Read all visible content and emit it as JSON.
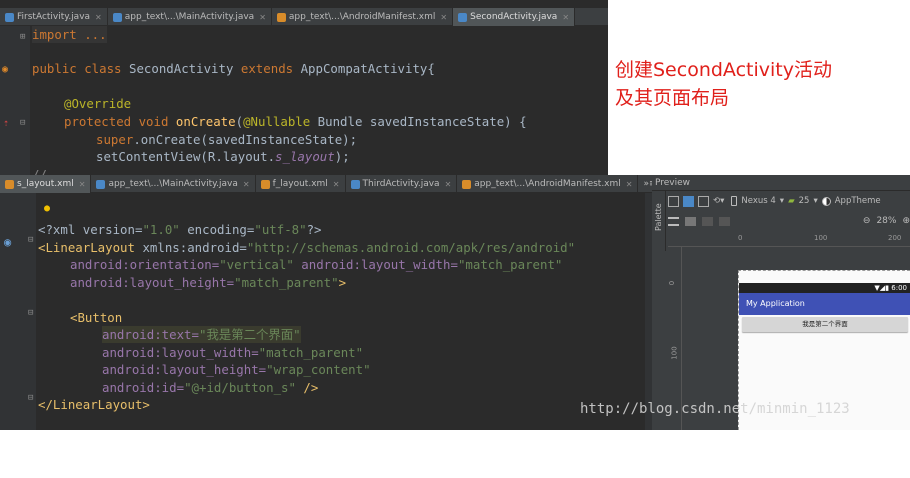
{
  "top_editor": {
    "tabs": [
      {
        "label": "FirstActivity.java",
        "icon": "java-class-icon"
      },
      {
        "label": "app_text\\...\\MainActivity.java",
        "icon": "java-class-icon"
      },
      {
        "label": "app_text\\...\\AndroidManifest.xml",
        "icon": "xml-file-icon"
      },
      {
        "label": "SecondActivity.java",
        "icon": "java-class-icon"
      }
    ],
    "active_tab": 3,
    "lines": {
      "l1": "import ...",
      "l2a": "public class ",
      "l2b": "SecondActivity ",
      "l2c": "extends ",
      "l2d": "AppCompatActivity{",
      "l3": "@Override",
      "l4a": "protected void ",
      "l4b": "onCreate",
      "l4c": "(",
      "l4d": "@Nullable",
      "l4e": " Bundle savedInstanceState) {",
      "l5a": "super",
      "l5b": ".onCreate(savedInstanceState);",
      "l6a": "setContentView(R.layout.",
      "l6b": "s_layout",
      "l6c": ");",
      "l7": "//"
    }
  },
  "annotation": {
    "line1": "创建SecondActivity活动",
    "line2": "及其页面布局",
    "color": "#e0201b"
  },
  "bottom_editor": {
    "tabs": [
      {
        "label": "s_layout.xml",
        "icon": "layout-file-icon"
      },
      {
        "label": "app_text\\...\\MainActivity.java",
        "icon": "java-class-icon"
      },
      {
        "label": "f_layout.xml",
        "icon": "layout-file-icon"
      },
      {
        "label": "ThirdActivity.java",
        "icon": "java-class-icon"
      },
      {
        "label": "app_text\\...\\AndroidManifest.xml",
        "icon": "xml-file-icon"
      }
    ],
    "overflow": "»≡2",
    "active_tab": 0,
    "lines": {
      "x1a": "<?xml version=",
      "x1b": "\"1.0\"",
      "x1c": " encoding=",
      "x1d": "\"utf-8\"",
      "x1e": "?>",
      "x2a": "<LinearLayout ",
      "x2b": "xmlns:android=",
      "x2c": "\"http://schemas.android.com/apk/res/android\"",
      "x3a": "android:orientation=",
      "x3b": "\"vertical\"",
      "x3c": " android:layout_width=",
      "x3d": "\"match_parent\"",
      "x4a": "android:layout_height=",
      "x4b": "\"match_parent\"",
      "x4c": ">",
      "x5": "<Button",
      "x6a": "android:text=",
      "x6b": "\"我是第二个界面\"",
      "x7a": "android:layout_width=",
      "x7b": "\"match_parent\"",
      "x8a": "android:layout_height=",
      "x8b": "\"wrap_content\"",
      "x9a": "android:id=",
      "x9b": "\"@+id/button_s\"",
      "x9c": " />",
      "x10": "</LinearLayout>"
    }
  },
  "preview": {
    "title": "Preview",
    "side_label": "Palette",
    "device": "Nexus 4",
    "api": "25",
    "theme": "AppTheme",
    "zoom": "28%",
    "ruler_h": [
      "0",
      "100",
      "200"
    ],
    "ruler_v": [
      "0",
      "100"
    ],
    "status_time": "6:00",
    "app_title": "My Application",
    "button_text": "我是第二个界面"
  },
  "watermark": "http://blog.csdn.net/minmin_1123"
}
